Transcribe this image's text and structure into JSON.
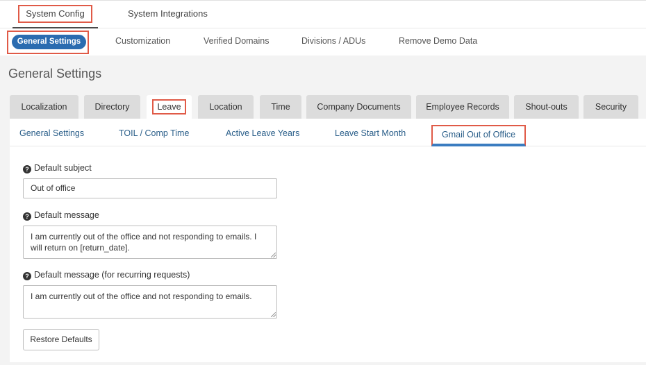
{
  "topnav": {
    "items": [
      "System Config",
      "System Integrations"
    ]
  },
  "subnav": {
    "active": "General Settings",
    "items": [
      "Customization",
      "Verified Domains",
      "Divisions / ADUs",
      "Remove Demo Data"
    ]
  },
  "page": {
    "title": "General Settings"
  },
  "tabs": [
    "Localization",
    "Directory",
    "Leave",
    "Location",
    "Time",
    "Company Documents",
    "Employee Records",
    "Shout-outs",
    "Security"
  ],
  "subtabs": [
    "General Settings",
    "TOIL / Comp Time",
    "Active Leave Years",
    "Leave Start Month",
    "Gmail Out of Office"
  ],
  "form": {
    "subject_label": "Default subject",
    "subject_value": "Out of office",
    "message_label": "Default message",
    "message_value": "I am currently out of the office and not responding to emails. I will return on [return_date].",
    "recurring_label": "Default message (for recurring requests)",
    "recurring_value": "I am currently out of the office and not responding to emails.",
    "restore_label": "Restore Defaults"
  },
  "icons": {
    "help": "question-circle-icon"
  },
  "colors": {
    "accent": "#2b6cb0",
    "highlight": "#e05a47",
    "link": "#2b5f8a"
  }
}
